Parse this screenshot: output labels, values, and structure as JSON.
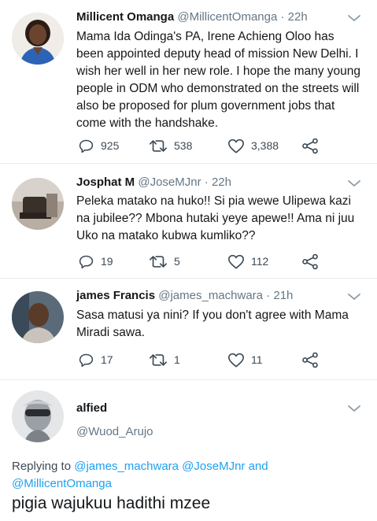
{
  "tweets": [
    {
      "name": "Millicent Omanga",
      "handle": "@MillicentOmanga",
      "time": "22h",
      "text": "Mama Ida Odinga's PA, Irene Achieng Oloo has been appointed deputy head of mission New Delhi. I wish her well in her new role. I hope the many young people in ODM who demonstrated on the streets will also be proposed for plum government jobs that come with the handshake.",
      "replies": "925",
      "retweets": "538",
      "likes": "3,388"
    },
    {
      "name": "Josphat M",
      "handle": "@JoseMJnr",
      "time": "22h",
      "text": "Peleka matako na huko!! Si pia wewe Ulipewa kazi na jubilee?? Mbona hutaki yeye apewe!! Ama ni juu Uko na matako kubwa kumliko??",
      "replies": "19",
      "retweets": "5",
      "likes": "112"
    },
    {
      "name": "james Francis",
      "handle": "@james_machwara",
      "time": "21h",
      "text": "Sasa matusi ya nini? If you don't agree with Mama Miradi sawa.",
      "replies": "17",
      "retweets": "1",
      "likes": "11"
    }
  ],
  "focus": {
    "name": "alfied",
    "handle": "@Wuod_Arujo",
    "replying_prefix": "Replying to",
    "replying_to_1": "@james_machwara",
    "replying_to_2": "@JoseMJnr",
    "replying_and": "and",
    "replying_to_3": "@MillicentOmanga",
    "text": "pigia wajukuu hadithi mzee"
  },
  "separator": "·",
  "colors": {
    "link": "#1da1f2",
    "secondary": "#657786",
    "text": "#14171a"
  }
}
